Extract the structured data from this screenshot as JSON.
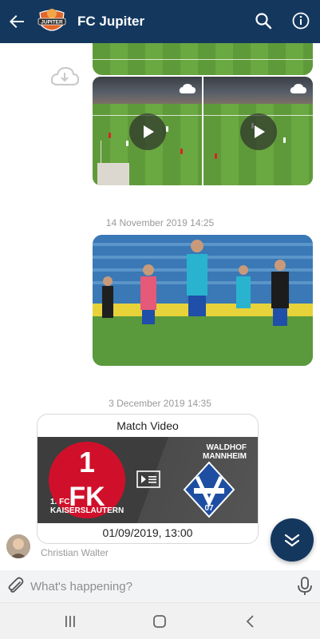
{
  "header": {
    "title": "FC Jupiter",
    "logo_text": "JUPITER",
    "icons": [
      "back-arrow-icon",
      "club-logo",
      "search-icon",
      "info-icon"
    ]
  },
  "messages": {
    "timestamp_1": "14 November 2019 14:25",
    "timestamp_2": "3 December 2019 14:35"
  },
  "match_card": {
    "title": "Match Video",
    "home_team": "1. FC\nKAISERSLAUTERN",
    "away_team": "WALDHOF\nMANNHEIM",
    "date": "01/09/2019, 13:00",
    "colors": {
      "home": "#d0102a",
      "away": "#1e4ea1"
    }
  },
  "sender": {
    "name": "Christian Walter"
  },
  "composer": {
    "placeholder": "What's happening?"
  },
  "colors": {
    "primary": "#14375e",
    "timestamp": "#9a9a9a"
  }
}
